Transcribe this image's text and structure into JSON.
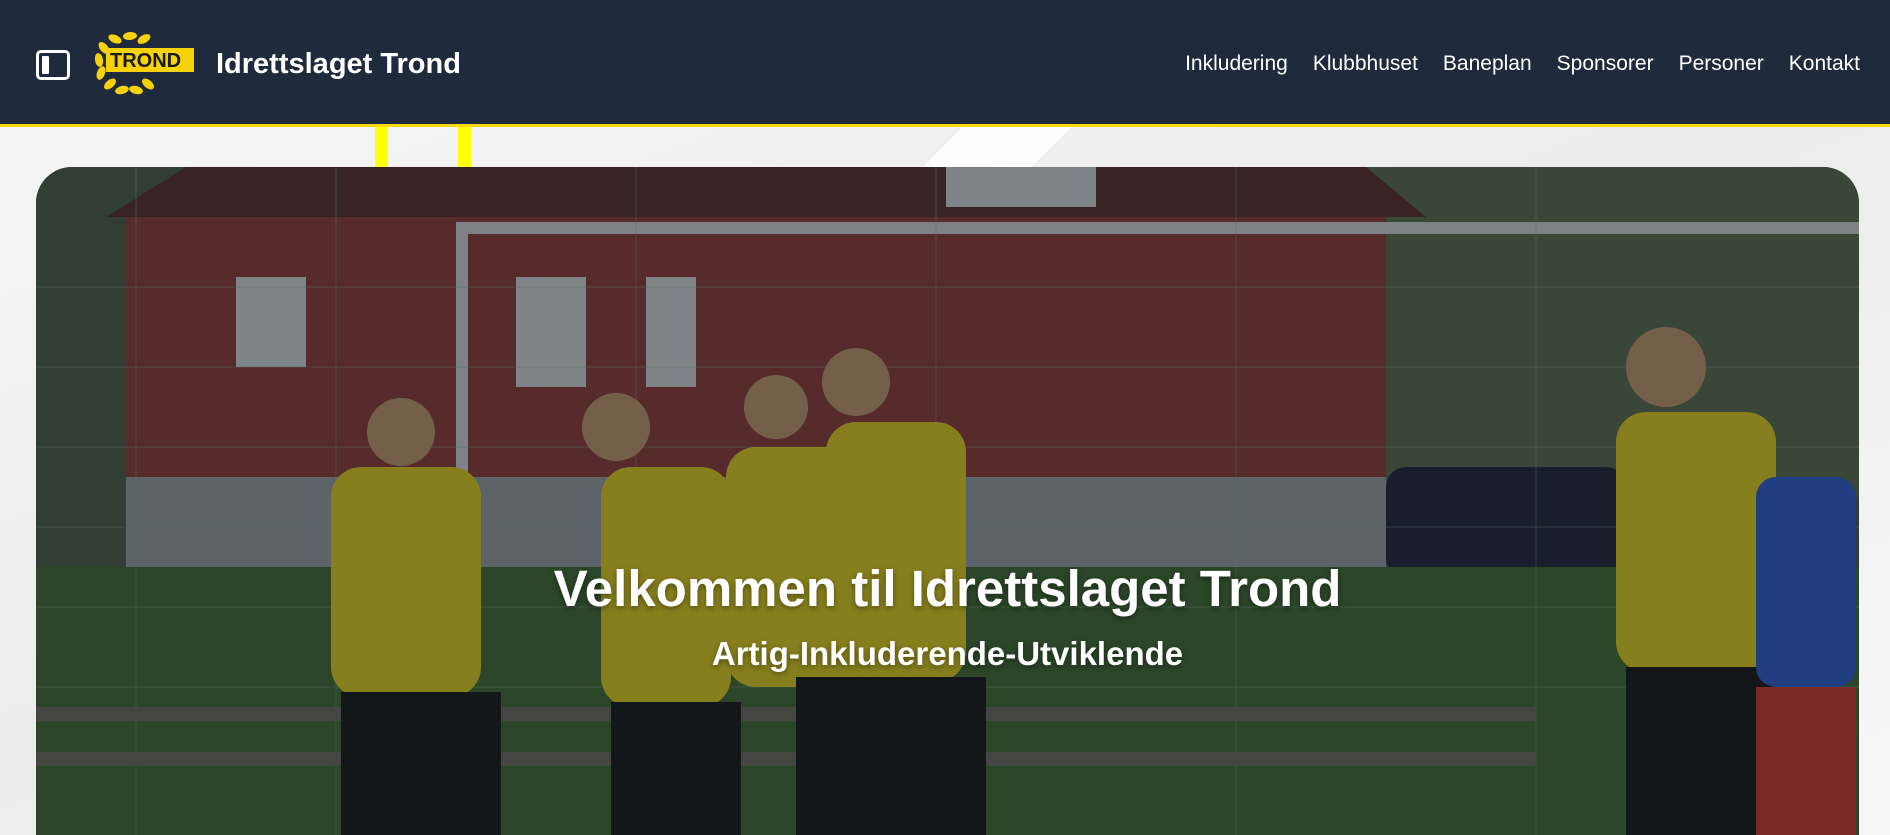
{
  "header": {
    "logo_text": "TROND",
    "site_title": "Idrettslaget Trond",
    "menu_toggle_icon": "sidebar-toggle-icon"
  },
  "nav": {
    "items": [
      {
        "label": "Inkludering"
      },
      {
        "label": "Klubbhuset"
      },
      {
        "label": "Baneplan"
      },
      {
        "label": "Sponsorer"
      },
      {
        "label": "Personer"
      },
      {
        "label": "Kontakt"
      }
    ]
  },
  "hero": {
    "title": "Velkommen til Idrettslaget Trond",
    "subtitle": "Artig-Inkluderende-Utviklende"
  },
  "colors": {
    "header_bg": "#1f2a3c",
    "accent": "#f5d90a",
    "logo_yellow": "#f5d20a"
  }
}
